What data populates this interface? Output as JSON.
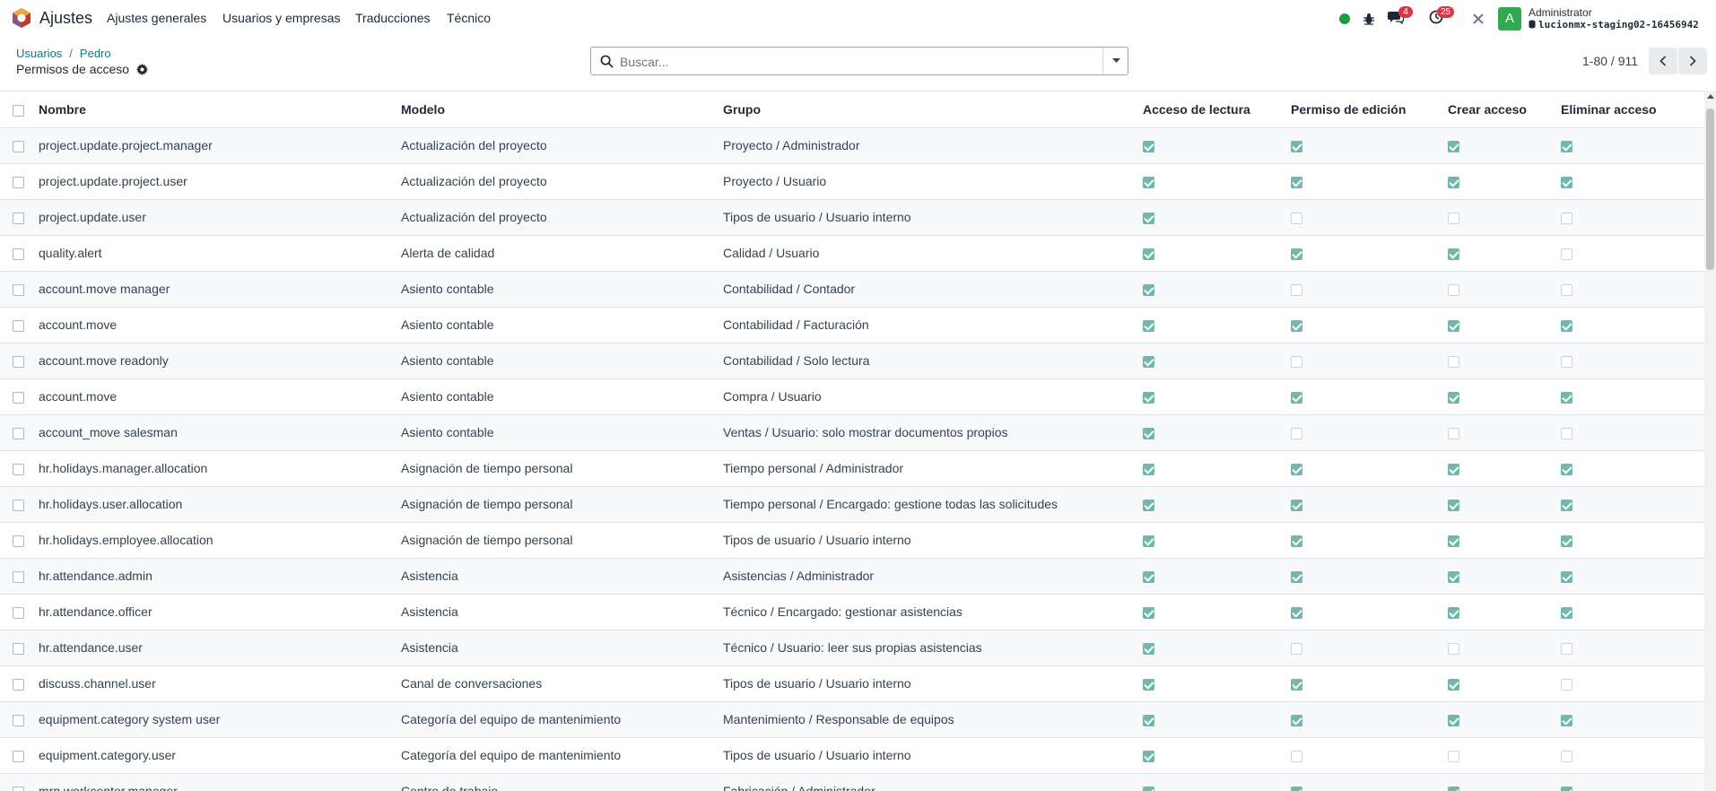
{
  "app": {
    "title": "Ajustes",
    "menu": [
      "Ajustes generales",
      "Usuarios y empresas",
      "Traducciones",
      "Técnico"
    ]
  },
  "systray": {
    "messages_count": "4",
    "activities_count": "25",
    "user_initial": "A",
    "user_name": "Administrator",
    "database": "lucionmx-staging02-16456942"
  },
  "breadcrumb": [
    "Usuarios",
    "Pedro"
  ],
  "page_title": "Permisos de acceso",
  "search": {
    "placeholder": "Buscar..."
  },
  "pager": {
    "value": "1-80 / 911"
  },
  "table": {
    "columns": [
      "Nombre",
      "Modelo",
      "Grupo",
      "Acceso de lectura",
      "Permiso de edición",
      "Crear acceso",
      "Eliminar acceso"
    ],
    "rows": [
      {
        "name": "project.update.project.manager",
        "model": "Actualización del proyecto",
        "group": "Proyecto / Administrador",
        "read": true,
        "write": true,
        "create": true,
        "unlink": true
      },
      {
        "name": "project.update.project.user",
        "model": "Actualización del proyecto",
        "group": "Proyecto / Usuario",
        "read": true,
        "write": true,
        "create": true,
        "unlink": true
      },
      {
        "name": "project.update.user",
        "model": "Actualización del proyecto",
        "group": "Tipos de usuario / Usuario interno",
        "read": true,
        "write": false,
        "create": false,
        "unlink": false
      },
      {
        "name": "quality.alert",
        "model": "Alerta de calidad",
        "group": "Calidad / Usuario",
        "read": true,
        "write": true,
        "create": true,
        "unlink": false
      },
      {
        "name": "account.move manager",
        "model": "Asiento contable",
        "group": "Contabilidad / Contador",
        "read": true,
        "write": false,
        "create": false,
        "unlink": false
      },
      {
        "name": "account.move",
        "model": "Asiento contable",
        "group": "Contabilidad / Facturación",
        "read": true,
        "write": true,
        "create": true,
        "unlink": true
      },
      {
        "name": "account.move readonly",
        "model": "Asiento contable",
        "group": "Contabilidad / Solo lectura",
        "read": true,
        "write": false,
        "create": false,
        "unlink": false
      },
      {
        "name": "account.move",
        "model": "Asiento contable",
        "group": "Compra / Usuario",
        "read": true,
        "write": true,
        "create": true,
        "unlink": true
      },
      {
        "name": "account_move salesman",
        "model": "Asiento contable",
        "group": "Ventas / Usuario: solo mostrar documentos propios",
        "read": true,
        "write": false,
        "create": false,
        "unlink": false
      },
      {
        "name": "hr.holidays.manager.allocation",
        "model": "Asignación de tiempo personal",
        "group": "Tiempo personal / Administrador",
        "read": true,
        "write": true,
        "create": true,
        "unlink": true
      },
      {
        "name": "hr.holidays.user.allocation",
        "model": "Asignación de tiempo personal",
        "group": "Tiempo personal / Encargado: gestione todas las solicitudes",
        "read": true,
        "write": true,
        "create": true,
        "unlink": true
      },
      {
        "name": "hr.holidays.employee.allocation",
        "model": "Asignación de tiempo personal",
        "group": "Tipos de usuario / Usuario interno",
        "read": true,
        "write": true,
        "create": true,
        "unlink": true
      },
      {
        "name": "hr.attendance.admin",
        "model": "Asistencia",
        "group": "Asistencias / Administrador",
        "read": true,
        "write": true,
        "create": true,
        "unlink": true
      },
      {
        "name": "hr.attendance.officer",
        "model": "Asistencia",
        "group": "Técnico / Encargado: gestionar asistencias",
        "read": true,
        "write": true,
        "create": true,
        "unlink": true
      },
      {
        "name": "hr.attendance.user",
        "model": "Asistencia",
        "group": "Técnico / Usuario: leer sus propias asistencias",
        "read": true,
        "write": false,
        "create": false,
        "unlink": false
      },
      {
        "name": "discuss.channel.user",
        "model": "Canal de conversaciones",
        "group": "Tipos de usuario / Usuario interno",
        "read": true,
        "write": true,
        "create": true,
        "unlink": false
      },
      {
        "name": "equipment.category system user",
        "model": "Categoría del equipo de mantenimiento",
        "group": "Mantenimiento / Responsable de equipos",
        "read": true,
        "write": true,
        "create": true,
        "unlink": true
      },
      {
        "name": "equipment.category.user",
        "model": "Categoría del equipo de mantenimiento",
        "group": "Tipos de usuario / Usuario interno",
        "read": true,
        "write": false,
        "create": false,
        "unlink": false
      },
      {
        "name": "mrp.workcenter.manager",
        "model": "Centro de trabajo",
        "group": "Fabricación / Administrador",
        "read": true,
        "write": true,
        "create": true,
        "unlink": true
      }
    ]
  }
}
